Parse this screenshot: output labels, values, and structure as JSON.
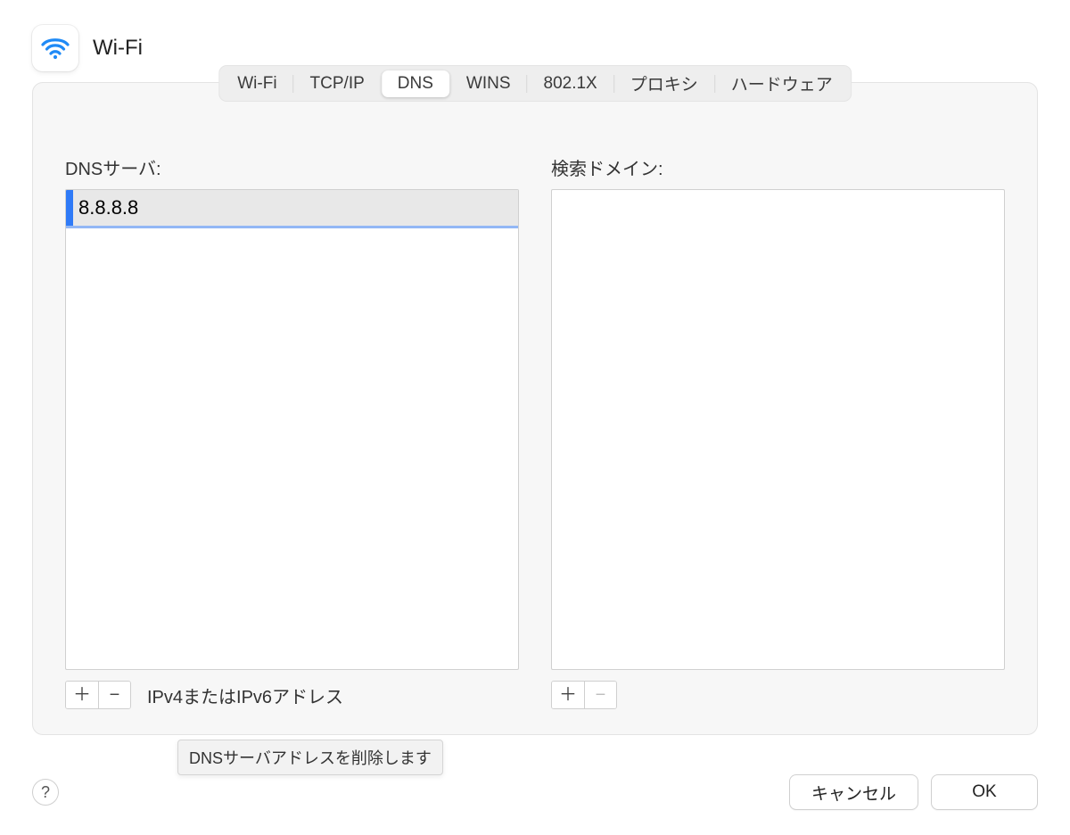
{
  "header": {
    "title": "Wi-Fi"
  },
  "tabs": {
    "items": [
      "Wi-Fi",
      "TCP/IP",
      "DNS",
      "WINS",
      "802.1X",
      "プロキシ",
      "ハードウェア"
    ],
    "active_index": 2
  },
  "dns": {
    "label": "DNSサーバ:",
    "entries": [
      "8.8.8.8"
    ],
    "hint": "IPv4またはIPv6アドレス",
    "tooltip": "DNSサーバアドレスを削除します"
  },
  "search_domains": {
    "label": "検索ドメイン:",
    "entries": []
  },
  "buttons": {
    "cancel": "キャンセル",
    "ok": "OK",
    "help": "?"
  },
  "glyphs": {
    "plus": "＋",
    "minus": "−"
  }
}
